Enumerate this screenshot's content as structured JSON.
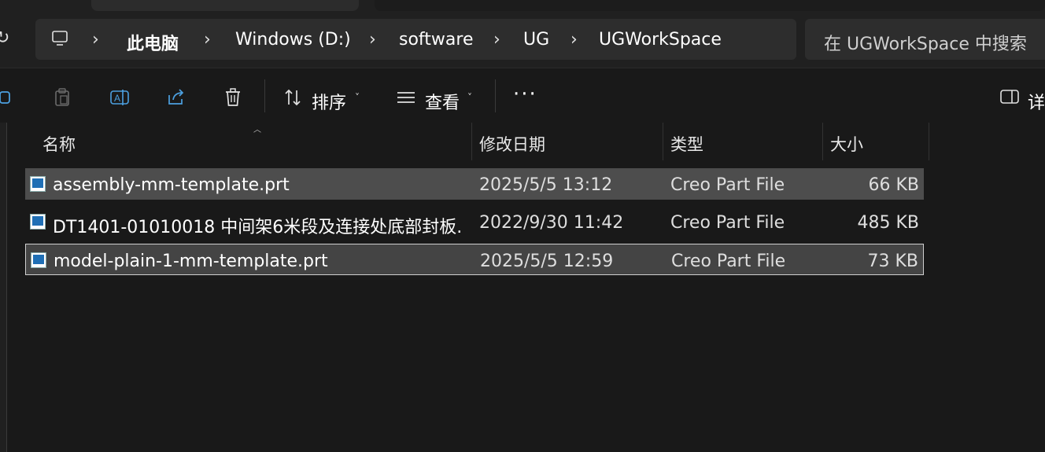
{
  "breadcrumb": [
    "此电脑",
    "Windows (D:)",
    "software",
    "UG",
    "UGWorkSpace"
  ],
  "search": {
    "placeholder": "在 UGWorkSpace 中搜索"
  },
  "toolbar": {
    "sort_label": "排序",
    "view_label": "查看",
    "more_label": "···",
    "details_label": "详"
  },
  "columns": {
    "name": "名称",
    "modified": "修改日期",
    "type": "类型",
    "size": "大小"
  },
  "files": [
    {
      "name": "assembly-mm-template.prt",
      "modified": "2025/5/5 13:12",
      "type": "Creo Part File",
      "size": "66 KB",
      "selected": true
    },
    {
      "name": "DT1401-01010018 中间架6米段及连接处底部封板...",
      "modified": "2022/9/30 11:42",
      "type": "Creo Part File",
      "size": "485 KB",
      "selected": false
    },
    {
      "name": "model-plain-1-mm-template.prt",
      "modified": "2025/5/5 12:59",
      "type": "Creo Part File",
      "size": "73 KB",
      "selected": true
    }
  ],
  "colors": {
    "background": "#191919",
    "bar": "#2d2d2d",
    "selection": "#4d4d4d",
    "accent": "#4ca0e0"
  }
}
